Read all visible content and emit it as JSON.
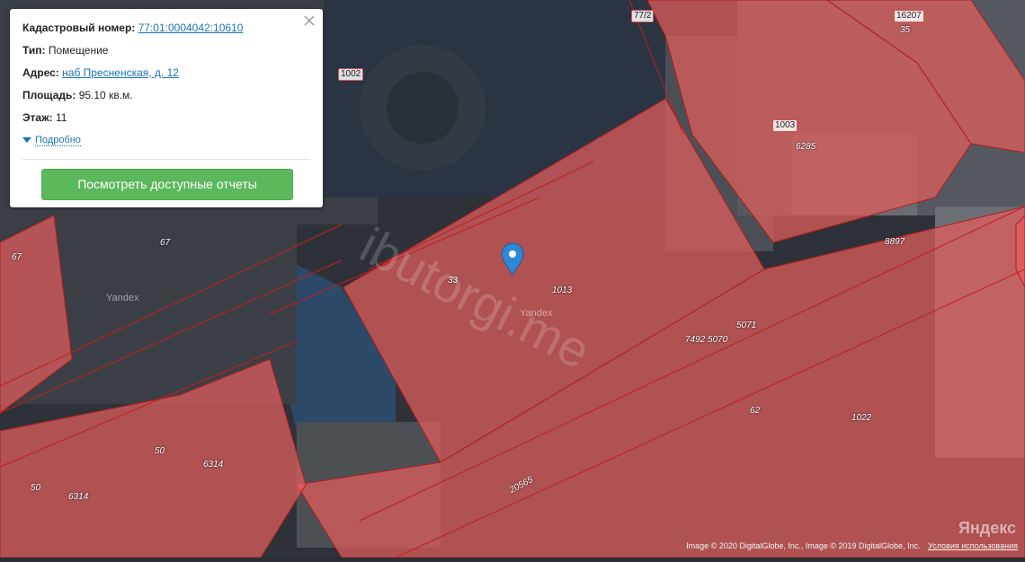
{
  "popup": {
    "cadastral_label": "Кадастровый номер:",
    "cadastral_value": "77:01:0004042:10610",
    "type_label": "Тип:",
    "type_value": "Помещение",
    "address_label": "Адрес:",
    "address_value": "наб Пресненская, д. 12",
    "area_label": "Площадь:",
    "area_value": "95.10 кв.м.",
    "floor_label": "Этаж:",
    "floor_value": "11",
    "more_label": "Подробно",
    "button_label": "Посмотреть доступные отчеты",
    "close_icon": "close-icon"
  },
  "map": {
    "boxed_labels": [
      "77/2",
      "16207",
      "1002",
      "1003"
    ],
    "parcel_numbers": [
      "35",
      "6285",
      "8897",
      "67",
      "67",
      "33",
      "1013",
      "5071",
      "7492 5070",
      "62",
      "1022",
      "50",
      "6314",
      "50",
      "6314",
      "20565"
    ],
    "yandex_marks": [
      "Yandex",
      "Yandex"
    ],
    "watermark": "ibutorgi.me",
    "marker_icon": "map-pin-icon",
    "parcel_fill": "#e35d5d",
    "parcel_line": "#b01e1e",
    "marker_color": "#2f87d6"
  },
  "attribution": {
    "copyright": "Image © 2020 DigitalGlobe, Inc., Image © 2019 DigitalGlobe, Inc.",
    "terms": "Условия использования",
    "logo": "Яндекс"
  }
}
